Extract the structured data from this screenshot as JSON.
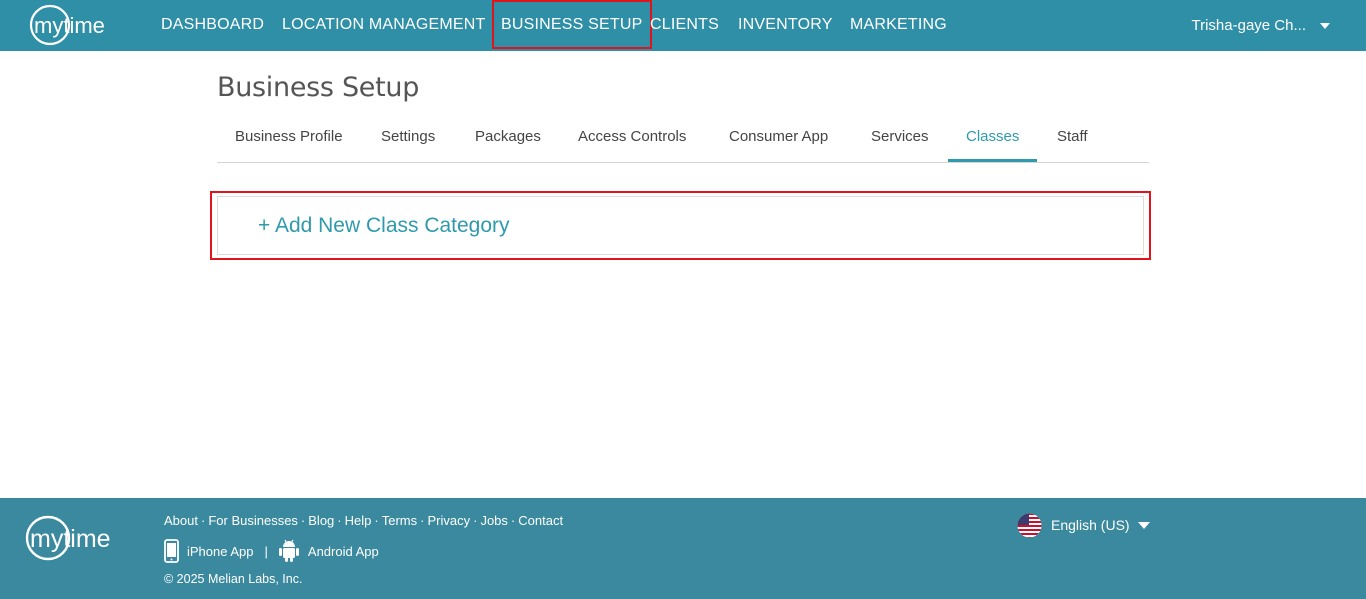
{
  "brand": {
    "logo_text": "mytime"
  },
  "nav": {
    "items": [
      {
        "label": "DASHBOARD"
      },
      {
        "label": "LOCATION MANAGEMENT"
      },
      {
        "label": "BUSINESS SETUP"
      },
      {
        "label": "CLIENTS"
      },
      {
        "label": "INVENTORY"
      },
      {
        "label": "MARKETING"
      }
    ],
    "user_name": "Trisha-gaye Ch..."
  },
  "page": {
    "title": "Business Setup",
    "tabs": [
      {
        "label": "Business Profile"
      },
      {
        "label": "Settings"
      },
      {
        "label": "Packages"
      },
      {
        "label": "Access Controls"
      },
      {
        "label": "Consumer App"
      },
      {
        "label": "Services"
      },
      {
        "label": "Classes"
      },
      {
        "label": "Staff"
      }
    ],
    "active_tab": "Classes",
    "add_category_label": "+ Add New Class Category"
  },
  "footer": {
    "links": [
      "About",
      "For Businesses",
      "Blog",
      "Help",
      "Terms",
      "Privacy",
      "Jobs",
      "Contact"
    ],
    "link_separator": "·",
    "iphone_app": "iPhone App",
    "android_app": "Android App",
    "app_separator": "|",
    "copyright": "© 2025 Melian Labs, Inc.",
    "language": "English (US)"
  },
  "colors": {
    "nav_bg": "#2f8fa6",
    "footer_bg": "#3a899e",
    "accent": "#2f9aad",
    "highlight_outline": "#e0141c"
  }
}
